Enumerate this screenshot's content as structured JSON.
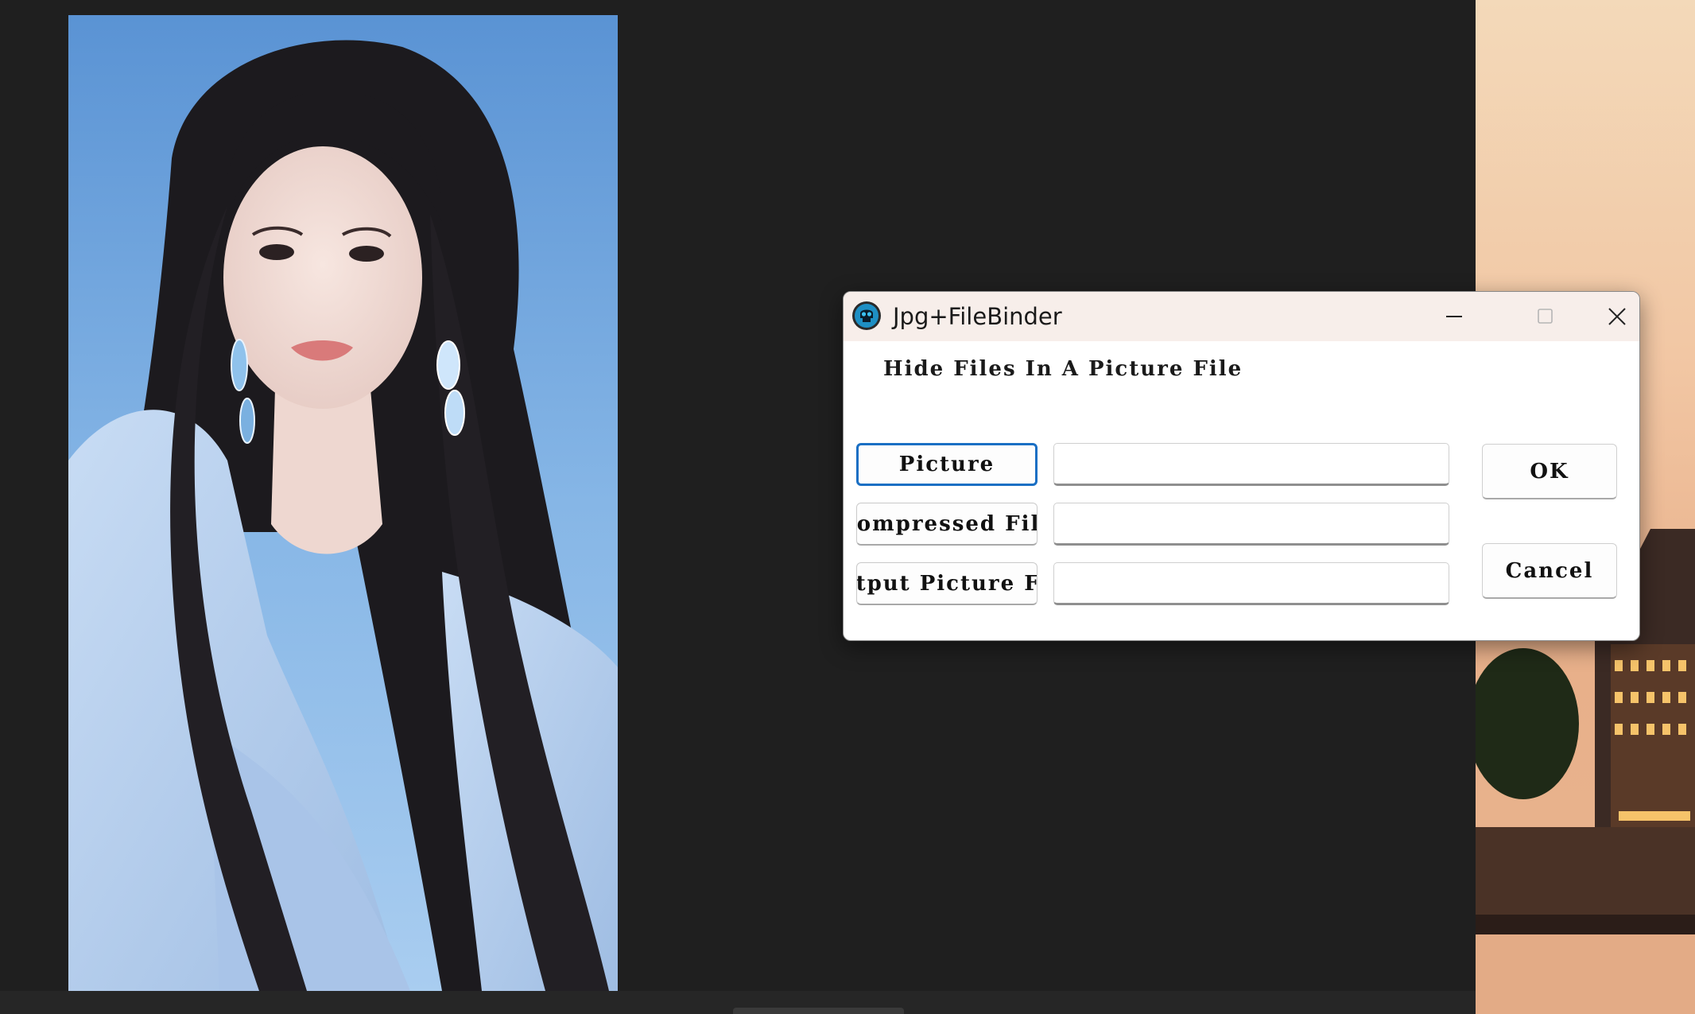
{
  "window": {
    "title": "Jpg+FileBinder",
    "icon": "skull-icon",
    "controls": {
      "minimize": "minimize-icon",
      "maximize": "maximize-icon",
      "close": "close-icon"
    }
  },
  "dialog": {
    "heading": "Hide Files In A Picture File",
    "rows": [
      {
        "button_label": "Picture",
        "value": ""
      },
      {
        "button_label": "Compressed File",
        "value": ""
      },
      {
        "button_label": "Output Picture File",
        "value": ""
      }
    ],
    "ok_label": "OK",
    "cancel_label": "Cancel"
  },
  "colors": {
    "titlebar": "#f7eeea",
    "focus_border": "#1a6fc4",
    "viewer_background": "#1f1f1f"
  }
}
